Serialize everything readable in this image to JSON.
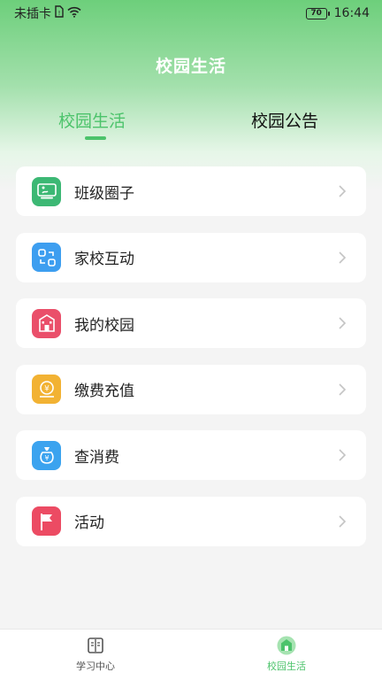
{
  "status_bar": {
    "carrier": "未插卡",
    "battery": "70",
    "time": "16:44"
  },
  "header": {
    "title": "校园生活"
  },
  "tabs": [
    {
      "label": "校园生活",
      "active": true
    },
    {
      "label": "校园公告",
      "active": false
    }
  ],
  "menu": {
    "items": [
      {
        "label": "班级圈子",
        "icon": "class-circle-icon",
        "color": "#3cb874"
      },
      {
        "label": "家校互动",
        "icon": "interaction-icon",
        "color": "#3d9ef0"
      },
      {
        "label": "我的校园",
        "icon": "school-building-icon",
        "color": "#ea4f6a"
      },
      {
        "label": "缴费充值",
        "icon": "payment-icon",
        "color": "#f2b233"
      },
      {
        "label": "查消费",
        "icon": "money-bag-icon",
        "color": "#3ba3ef"
      },
      {
        "label": "活动",
        "icon": "flag-icon",
        "color": "#ec4b63"
      }
    ]
  },
  "bottom_nav": {
    "items": [
      {
        "label": "学习中心",
        "icon": "book-icon",
        "active": false
      },
      {
        "label": "校园生活",
        "icon": "campus-home-icon",
        "active": true
      }
    ]
  },
  "colors": {
    "accent": "#4cc36b",
    "header_gradient_top": "#6dcf7b"
  }
}
